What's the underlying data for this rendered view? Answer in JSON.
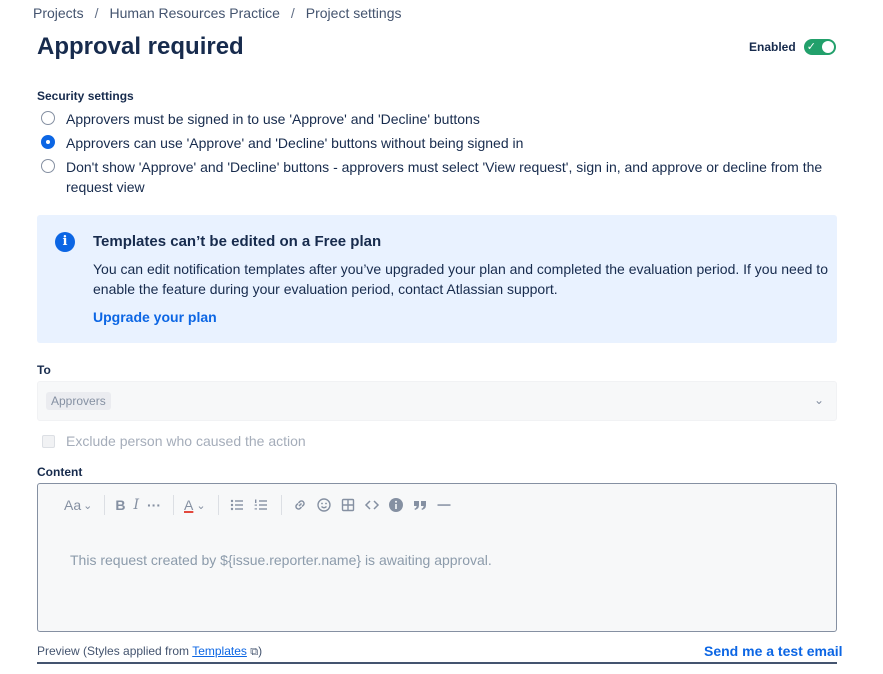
{
  "breadcrumb": {
    "items": [
      "Projects",
      "Human Resources Practice",
      "Project settings"
    ],
    "separator": "/"
  },
  "header": {
    "title": "Approval required",
    "enabled_label": "Enabled",
    "enabled": true,
    "toggle_check": "✓"
  },
  "security": {
    "label": "Security settings",
    "options": [
      {
        "label": "Approvers must be signed in to use 'Approve' and 'Decline' buttons",
        "checked": false
      },
      {
        "label": "Approvers can use 'Approve' and 'Decline' buttons without being signed in",
        "checked": true
      },
      {
        "label": "Don't show 'Approve' and 'Decline' buttons - approvers must select 'View request', sign in, and approve or decline from the request view",
        "checked": false
      }
    ]
  },
  "info_panel": {
    "icon": "info-icon",
    "icon_glyph": "i",
    "title": "Templates can’t be edited on a Free plan",
    "body": "You can edit notification templates after you’ve upgraded your plan and completed the evaluation period. If you need to enable the feature during your evaluation period, contact Atlassian support.",
    "link": "Upgrade your plan"
  },
  "to": {
    "label": "To",
    "chip": "Approvers",
    "chevron": "⌄"
  },
  "exclude": {
    "label": "Exclude person who caused the action",
    "checked": false
  },
  "content": {
    "label": "Content",
    "toolbar": {
      "text_style": "Aa",
      "bold": "B",
      "italic": "I",
      "more": "···",
      "text_color": "A",
      "caret": "⌄"
    },
    "placeholder": "This request created by ${issue.reporter.name} is awaiting approval."
  },
  "preview": {
    "label": "Preview (Styles applied from",
    "link": "Templates",
    "external_icon": "⧉",
    "close": ")",
    "send_test": "Send me a test email"
  },
  "colors": {
    "accent": "#0c66e4",
    "toggle_on": "#22a06b",
    "info_bg": "#e9f2ff"
  }
}
